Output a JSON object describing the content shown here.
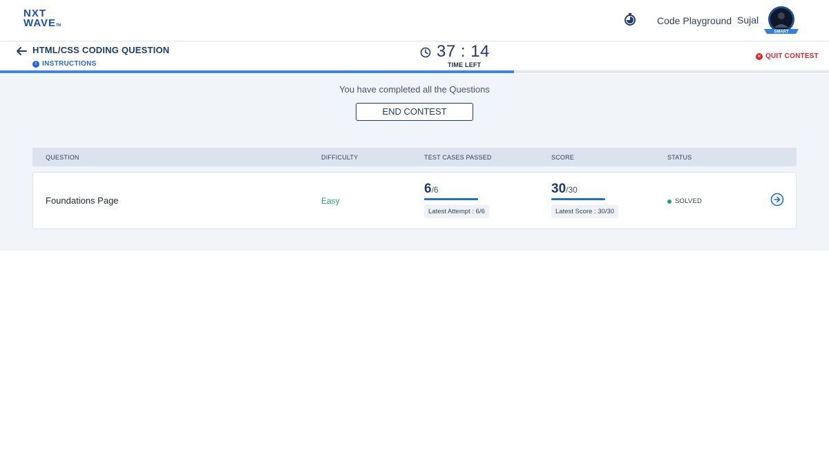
{
  "topnav": {
    "logo_line1": "NXT",
    "logo_line2": "WAVE",
    "logo_tm": "TM",
    "timer_icon": "stopwatch-icon",
    "code_playground": "Code Playground",
    "username": "Sujal",
    "avatar_badge": "SMART"
  },
  "contest": {
    "title": "HTML/CSS CODING QUESTION",
    "instructions": "INSTRUCTIONS",
    "timer": "37 : 14",
    "timer_label": "TIME LEFT",
    "quit": "QUIT CONTEST",
    "progress": 0.62
  },
  "main": {
    "completed_msg": "You have completed all the Questions",
    "end_contest": "END CONTEST"
  },
  "table": {
    "headers": [
      "QUESTION",
      "DIFFICULTY",
      "TEST CASES PASSED",
      "SCORE",
      "STATUS"
    ],
    "rows": [
      {
        "question": "Foundations Page",
        "difficulty": "Easy",
        "tests_passed": "6",
        "tests_total": "/6",
        "latest_attempt": "Latest Attempt : 6/6",
        "score": "30",
        "score_total": "/30",
        "latest_score": "Latest Score : 30/30",
        "status": "SOLVED"
      }
    ]
  },
  "colors": {
    "brand": "#1b4fb4",
    "primary_text": "#1e3a6e",
    "easy": "#22a06b",
    "quit": "#dc2626",
    "progress": "#3b82f6"
  }
}
